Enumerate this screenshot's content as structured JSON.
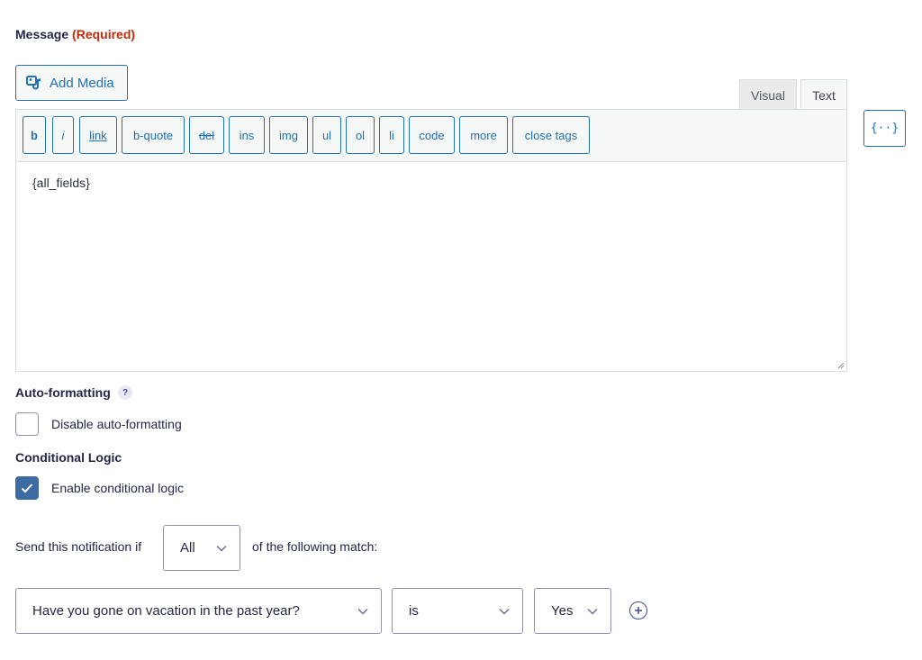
{
  "field": {
    "label": "Message",
    "required": "(Required)"
  },
  "media": {
    "add_label": "Add Media"
  },
  "tabs": {
    "visual": "Visual",
    "text": "Text"
  },
  "toolbar": {
    "buttons": [
      "b",
      "i",
      "link",
      "b-quote",
      "del",
      "ins",
      "img",
      "ul",
      "ol",
      "li",
      "code",
      "more",
      "close tags"
    ]
  },
  "editor": {
    "content": "{all_fields}"
  },
  "merge_tag": {
    "label": "{··}"
  },
  "auto_format": {
    "heading": "Auto-formatting",
    "help": "?",
    "checkbox_label": "Disable auto-formatting"
  },
  "conditional": {
    "heading": "Conditional Logic",
    "checkbox_label": "Enable conditional logic",
    "send_prefix": "Send this notification if",
    "match_value": "All",
    "send_suffix": "of the following match:"
  },
  "rule": {
    "field": "Have you gone on vacation in the past year?",
    "operator": "is",
    "value": "Yes"
  },
  "colors": {
    "accent": "#2271b1",
    "required": "#c02b0a",
    "checkbox": "#3e6ca2",
    "text": "#242748"
  }
}
